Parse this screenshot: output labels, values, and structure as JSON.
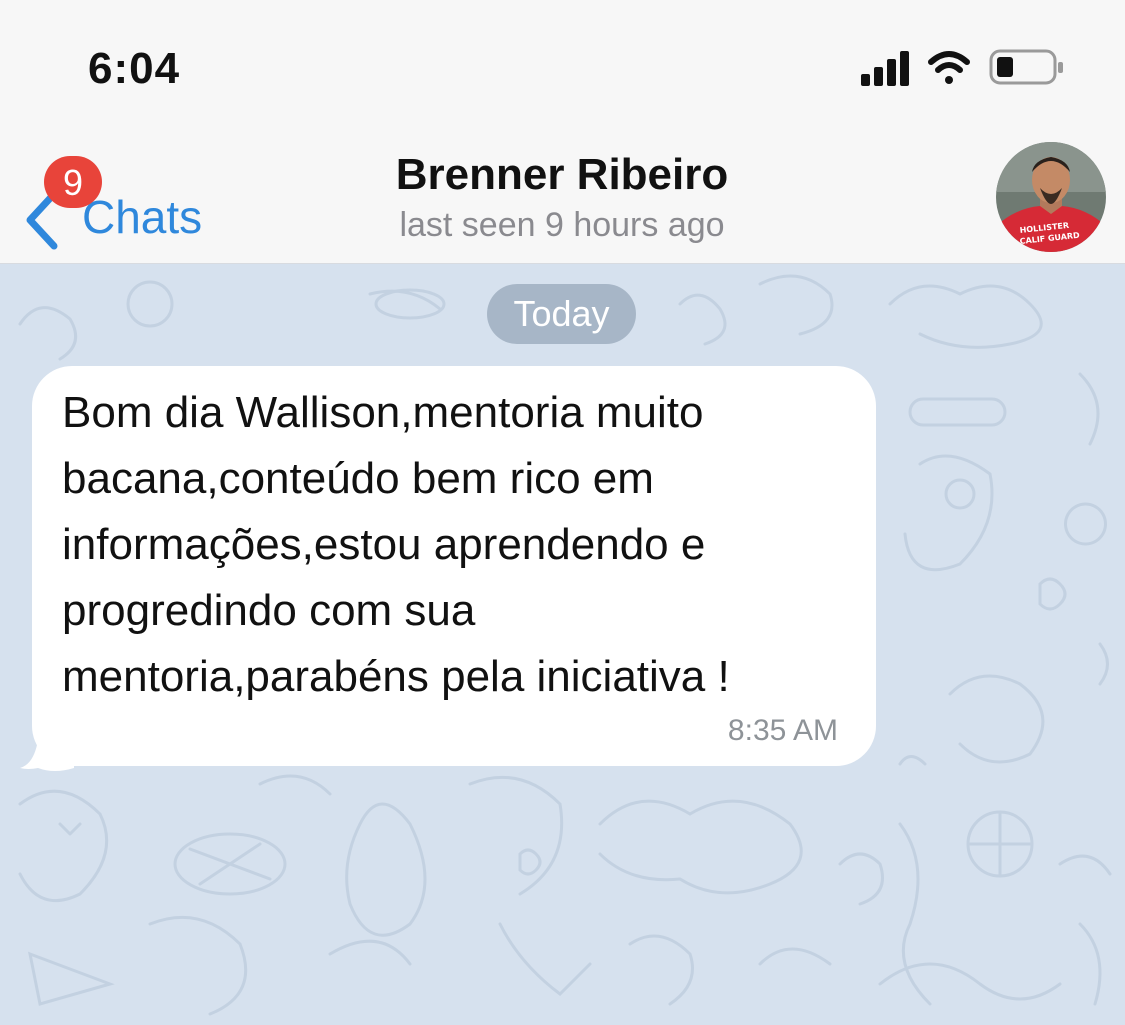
{
  "status_bar": {
    "time": "6:04",
    "icons": [
      "cellular-signal-icon",
      "wifi-icon",
      "battery-icon"
    ]
  },
  "nav": {
    "back_label": "Chats",
    "unread_count": "9",
    "contact_name": "Brenner Ribeiro",
    "last_seen": "last seen 9 hours ago",
    "avatar_shirt_text": "HOLLISTER CALIF GUARD"
  },
  "chat": {
    "date_separator": "Today",
    "messages": [
      {
        "text": "Bom dia Wallison,mentoria muito bacana,conteúdo bem rico em informações,estou aprendendo e progredindo com sua mentoria,parabéns pela iniciativa !",
        "time": "8:35 AM",
        "direction": "incoming"
      }
    ]
  },
  "colors": {
    "accent": "#2f88dc",
    "badge": "#e8443a",
    "wallpaper": "#d6e1ee",
    "bubble": "#ffffff",
    "bar_background": "#f7f7f7"
  }
}
